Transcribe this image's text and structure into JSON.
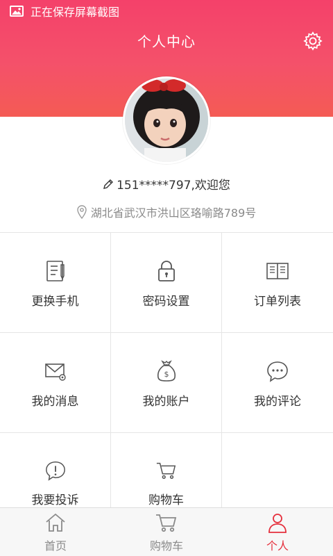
{
  "status_bar": {
    "text": "正在保存屏幕截图",
    "icon": "image-icon"
  },
  "header": {
    "title": "个人中心",
    "settings_icon": "gear-icon"
  },
  "profile": {
    "avatar_icon": "avatar",
    "greeting": "151*****797,欢迎您",
    "address": "湖北省武汉市洪山区珞喻路789号"
  },
  "grid": [
    {
      "label": "更换手机",
      "icon": "document-icon"
    },
    {
      "label": "密码设置",
      "icon": "lock-icon"
    },
    {
      "label": "订单列表",
      "icon": "book-icon"
    },
    {
      "label": "我的消息",
      "icon": "mail-icon"
    },
    {
      "label": "我的账户",
      "icon": "money-bag-icon"
    },
    {
      "label": "我的评论",
      "icon": "chat-bubble-icon"
    },
    {
      "label": "我要投诉",
      "icon": "alert-bubble-icon"
    },
    {
      "label": "购物车",
      "icon": "cart-icon"
    }
  ],
  "bottom_nav": [
    {
      "label": "首页",
      "icon": "home-icon"
    },
    {
      "label": "购物车",
      "icon": "cart-icon"
    },
    {
      "label": "个人",
      "icon": "person-icon",
      "active": true
    }
  ],
  "colors": {
    "accent": "#e5303d",
    "header_top": "#f4416a",
    "header_bottom": "#f45b54"
  }
}
